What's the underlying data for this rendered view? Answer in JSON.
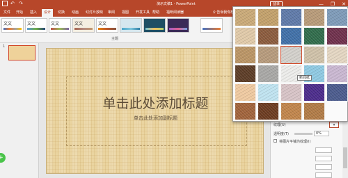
{
  "titlebar": {
    "doc_title": "演示文稿1 - PowerPoint",
    "login": "登录",
    "min": "—",
    "restore": "❐",
    "close": "✕"
  },
  "tabs": [
    "文件",
    "开始",
    "插入",
    "设计",
    "切换",
    "动画",
    "幻灯片放映",
    "审阅",
    "视图",
    "开发工具",
    "帮助",
    "福昕阅读器"
  ],
  "active_tab": "设计",
  "tell_me": "♀ 告诉我你想要做什么",
  "ribbon": {
    "theme_label": "文文",
    "group_label": "主题"
  },
  "left_panel": {
    "slide_number": "1",
    "side_button": "+"
  },
  "slide": {
    "title_placeholder": "单击此处添加标题",
    "subtitle_placeholder": "单击此处添加副标题"
  },
  "format_pane": {
    "texture_label": "纹理(U)",
    "transparency_label": "透明度(T)",
    "transparency_value": "0%",
    "tile_label": "将图片平铺为纹理(I)"
  },
  "gallery": {
    "tooltip": "新闻纸",
    "textures": [
      "#c9a977",
      "#c2a06a",
      "#5e79a8",
      "#b79a78",
      "#7d9ab8",
      "#e0c9a8",
      "#8a5a3c",
      "#3f6fa7",
      "#2f6b4a",
      "#6e2f4b",
      "#ba9464",
      "#b69a7b",
      "#d3d0cb",
      "#cfc1a8",
      "#e4d6c2",
      "#5b3b25",
      "#a8a7a5",
      "#ececea",
      "#8ec9e2",
      "#c9b7d1",
      "#efc9a0",
      "#bfe3f0",
      "#d7c3c6",
      "#4a2a8a",
      "#4a5a8c",
      "#a0623a",
      "#6b3a1f",
      "#c0844a",
      "#b07a45"
    ]
  },
  "colors": {
    "accent": "#b7472a",
    "slide_bg": "#ead4a0"
  }
}
